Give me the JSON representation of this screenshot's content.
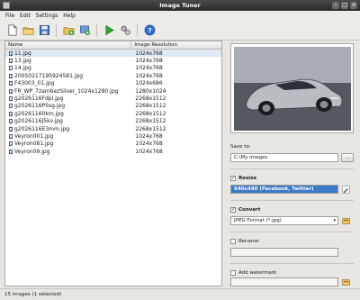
{
  "window": {
    "title": "Image Tuner"
  },
  "menu": [
    "File",
    "Edit",
    "Settings",
    "Help"
  ],
  "toolbar": {
    "icons": [
      "new-icon",
      "open-folder-icon",
      "save-icon",
      "add-images-icon",
      "add-folder-icon",
      "start-icon",
      "settings-icon",
      "help-icon"
    ]
  },
  "list": {
    "columns": [
      "Name",
      "Image Resolution"
    ],
    "rows": [
      {
        "name": "11.jpg",
        "res": "1024x768"
      },
      {
        "name": "13.jpg",
        "res": "1024x768"
      },
      {
        "name": "14.jpg",
        "res": "1024x768"
      },
      {
        "name": "20050217195924581.jpg",
        "res": "1024x768"
      },
      {
        "name": "F43003_01.jpg",
        "res": "1024x686"
      },
      {
        "name": "FR_WP_7zambezSilver_1024x1280.jpg",
        "res": "1280x1024"
      },
      {
        "name": "g2026116Fdpl.jpg",
        "res": "2268x1512"
      },
      {
        "name": "g2026116PSsg.jpg",
        "res": "2268x1512"
      },
      {
        "name": "g20261160km.jpg",
        "res": "2268x1512"
      },
      {
        "name": "g2026116J5kv.jpg",
        "res": "2268x1512"
      },
      {
        "name": "g2026116E3mm.jpg",
        "res": "2268x1512"
      },
      {
        "name": "Veyron001.jpg",
        "res": "1024x768"
      },
      {
        "name": "Veyron081.jpg",
        "res": "1024x768"
      },
      {
        "name": "Veyron09.jpg",
        "res": "1024x768"
      }
    ]
  },
  "save_to": {
    "label": "Save to:",
    "value": "C:\\My images",
    "browse_label": "..."
  },
  "resize": {
    "label": "Resize",
    "checked": true,
    "value": "640x480 (Facebook, Twitter)"
  },
  "convert": {
    "label": "Convert",
    "checked": true,
    "value": "JPEG Format (*.jpg)"
  },
  "rename": {
    "label": "Rename",
    "checked": false,
    "value": ""
  },
  "watermark": {
    "label": "Add watermark",
    "checked": false,
    "value": ""
  },
  "status": {
    "text": "15 images (1 selected)"
  }
}
